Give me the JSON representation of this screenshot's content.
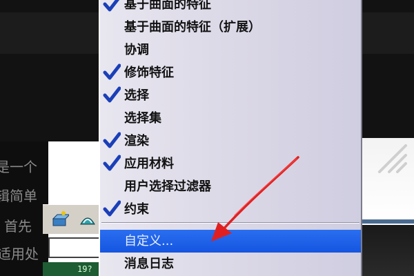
{
  "background": {
    "left_text_fragments": [
      "是一个",
      "辑简单",
      "首先",
      "适用处"
    ]
  },
  "toolbar": {
    "status_text": "19?"
  },
  "menu": {
    "items": [
      {
        "label": "基于曲面的特征",
        "checked": true
      },
      {
        "label": "基于曲面的特征（扩展）",
        "checked": false
      },
      {
        "label": "协调",
        "checked": false
      },
      {
        "label": "修饰特征",
        "checked": true
      },
      {
        "label": "选择",
        "checked": true
      },
      {
        "label": "选择集",
        "checked": false
      },
      {
        "label": "渲染",
        "checked": true
      },
      {
        "label": "应用材料",
        "checked": true
      },
      {
        "label": "用户选择过滤器",
        "checked": false
      },
      {
        "label": "约束",
        "checked": true
      }
    ],
    "customize_label": "自定义...",
    "message_log_label": "消息日志"
  },
  "colors": {
    "menu_highlight": "#1a5ce6",
    "checkmark": "#1a3fb8",
    "annotation_arrow": "#e02020"
  }
}
